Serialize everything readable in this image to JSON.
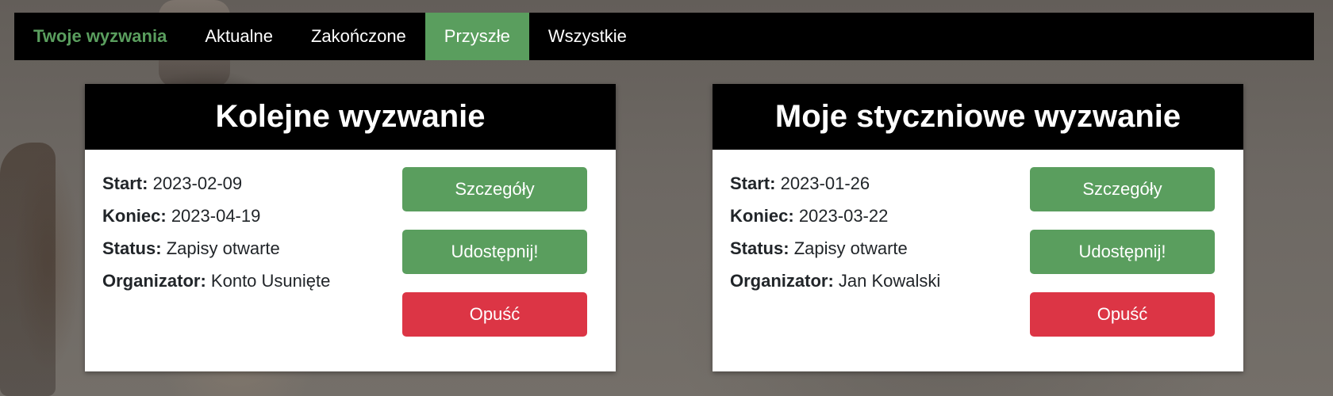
{
  "navbar": {
    "brand": "Twoje wyzwania",
    "items": [
      {
        "label": "Aktualne",
        "active": false
      },
      {
        "label": "Zakończone",
        "active": false
      },
      {
        "label": "Przyszłe",
        "active": true
      },
      {
        "label": "Wszystkie",
        "active": false
      }
    ]
  },
  "labels": {
    "start": "Start:",
    "end": "Koniec:",
    "status": "Status:",
    "organizer": "Organizator:"
  },
  "buttons": {
    "details": "Szczegóły",
    "share": "Udostępnij!",
    "leave": "Opuść"
  },
  "challenges": [
    {
      "title": "Kolejne wyzwanie",
      "start": "2023-02-09",
      "end": "2023-04-19",
      "status": "Zapisy otwarte",
      "organizer": "Konto Usunięte"
    },
    {
      "title": "Moje styczniowe wyzwanie",
      "start": "2023-01-26",
      "end": "2023-03-22",
      "status": "Zapisy otwarte",
      "organizer": "Jan Kowalski"
    }
  ],
  "colors": {
    "accent": "#5a9e5e",
    "danger": "#dc3545",
    "header": "#000000"
  }
}
